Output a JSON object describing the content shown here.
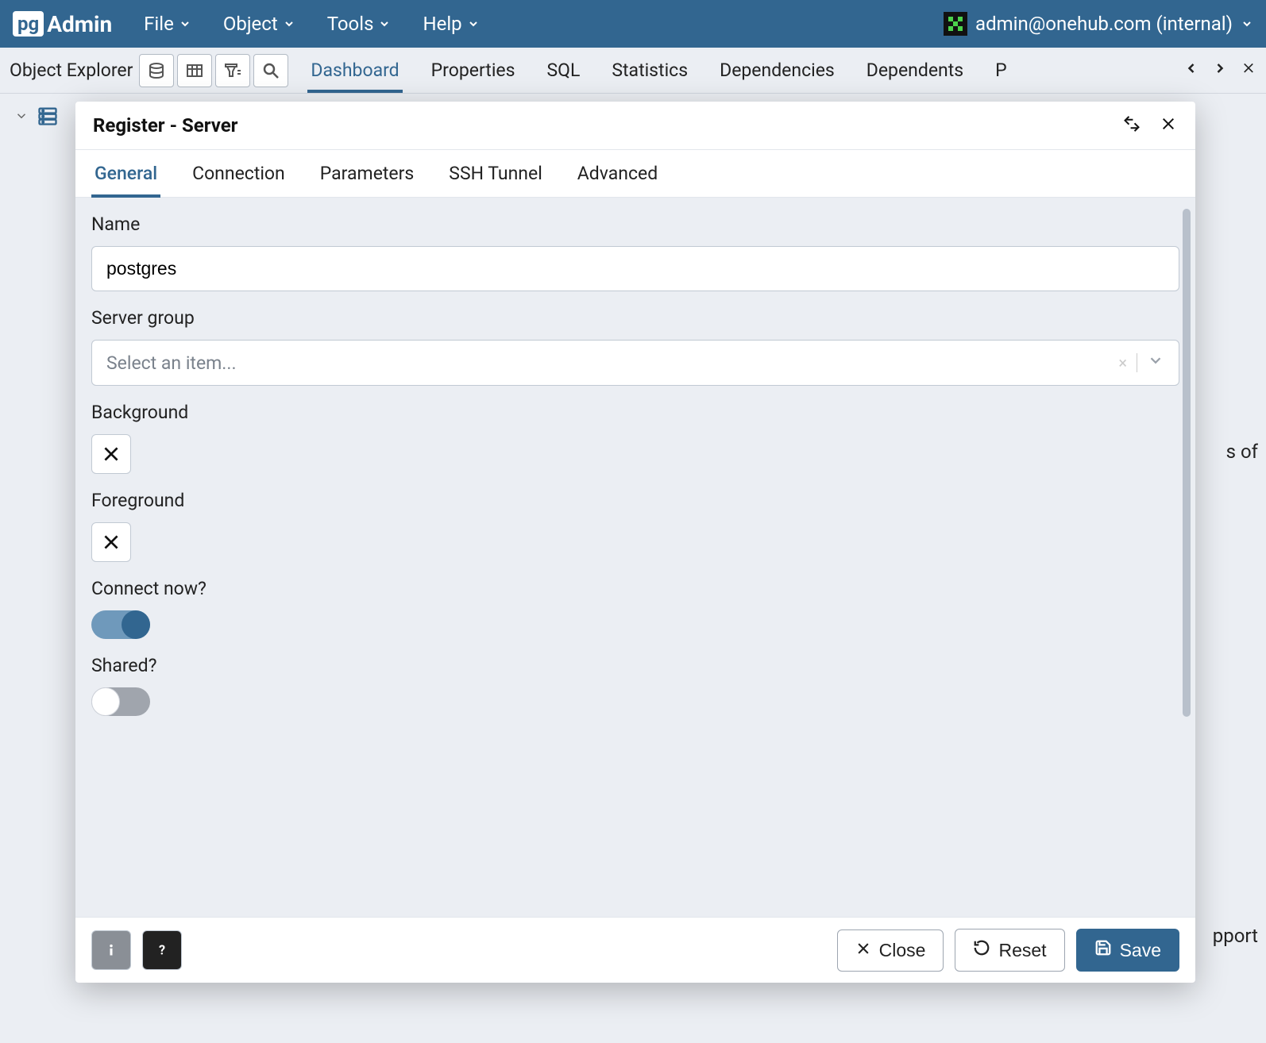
{
  "header": {
    "app_name_short": "pg",
    "app_name_rest": "Admin",
    "menus": [
      "File",
      "Object",
      "Tools",
      "Help"
    ],
    "user_label": "admin@onehub.com (internal)"
  },
  "explorer": {
    "title": "Object Explorer"
  },
  "main_tabs": {
    "items": [
      "Dashboard",
      "Properties",
      "SQL",
      "Statistics",
      "Dependencies",
      "Dependents"
    ],
    "overflow_hint": "P",
    "active_index": 0
  },
  "bg_fragments": {
    "line1": "s of",
    "line2": "pport"
  },
  "dialog": {
    "title": "Register - Server",
    "tabs": [
      "General",
      "Connection",
      "Parameters",
      "SSH Tunnel",
      "Advanced"
    ],
    "active_tab_index": 0,
    "fields": {
      "name_label": "Name",
      "name_value": "postgres",
      "server_group_label": "Server group",
      "server_group_placeholder": "Select an item...",
      "background_label": "Background",
      "foreground_label": "Foreground",
      "connect_now_label": "Connect now?",
      "connect_now_value": true,
      "shared_label": "Shared?",
      "shared_value": false
    },
    "footer": {
      "close_label": "Close",
      "reset_label": "Reset",
      "save_label": "Save"
    }
  }
}
